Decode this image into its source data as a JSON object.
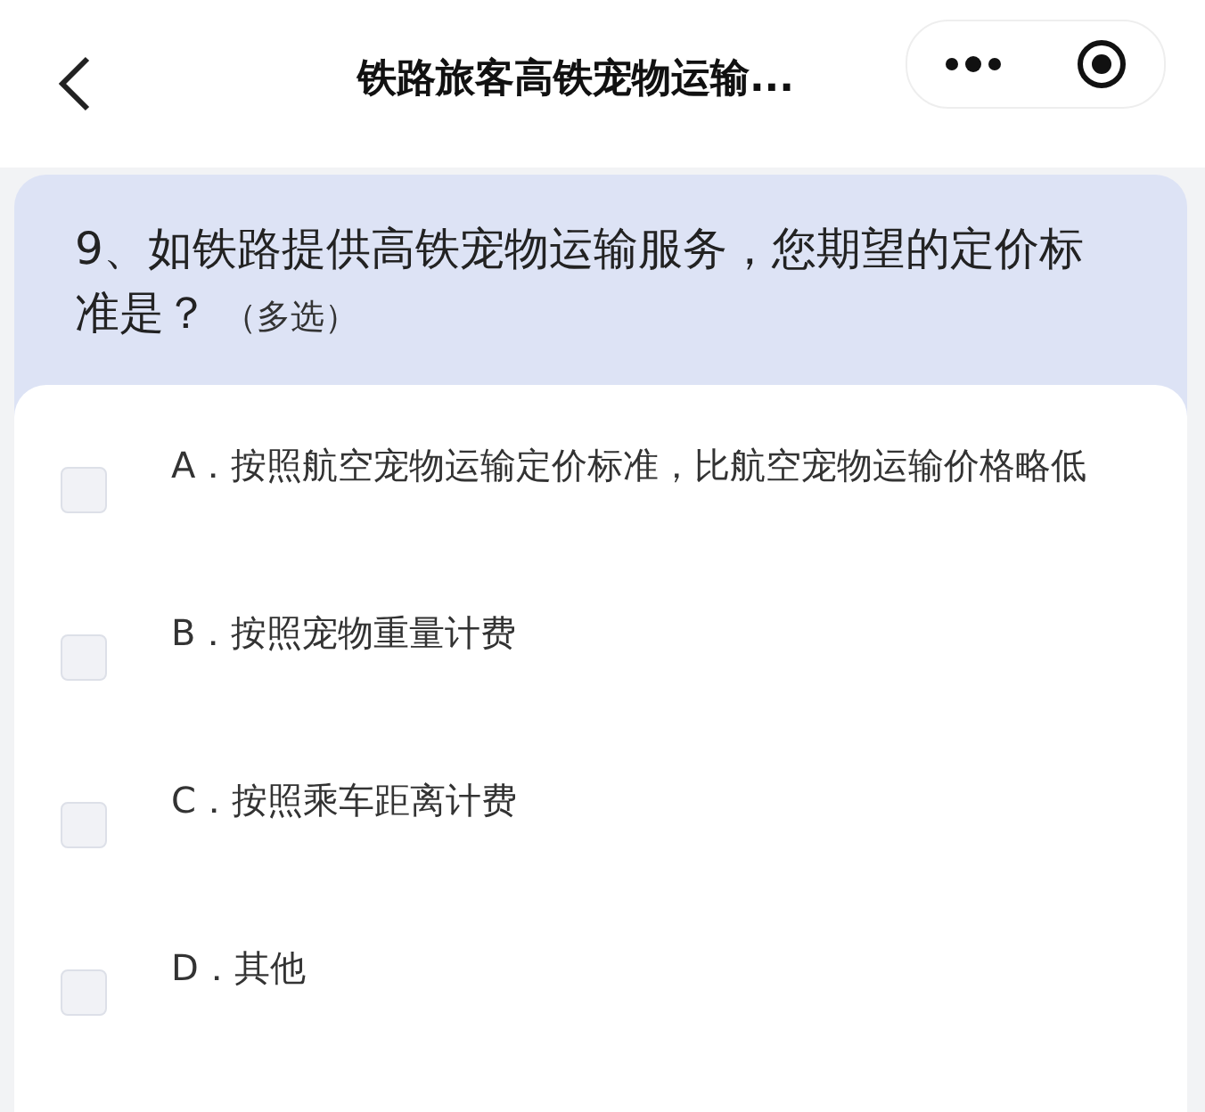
{
  "nav_bar": {
    "title": "铁路旅客高铁宠物运输..."
  },
  "question": {
    "text": "9、如铁路提供高铁宠物运输服务，您期望的定价标准是？",
    "tag": "（多选）"
  },
  "options": [
    {
      "label": "A．按照航空宠物运输定价标准，比航空宠物运输价格略低",
      "checked": false
    },
    {
      "label": "B．按照宠物重量计费",
      "checked": false
    },
    {
      "label": "C．按照乘车距离计费",
      "checked": false
    },
    {
      "label": "D．其他",
      "checked": false
    }
  ]
}
